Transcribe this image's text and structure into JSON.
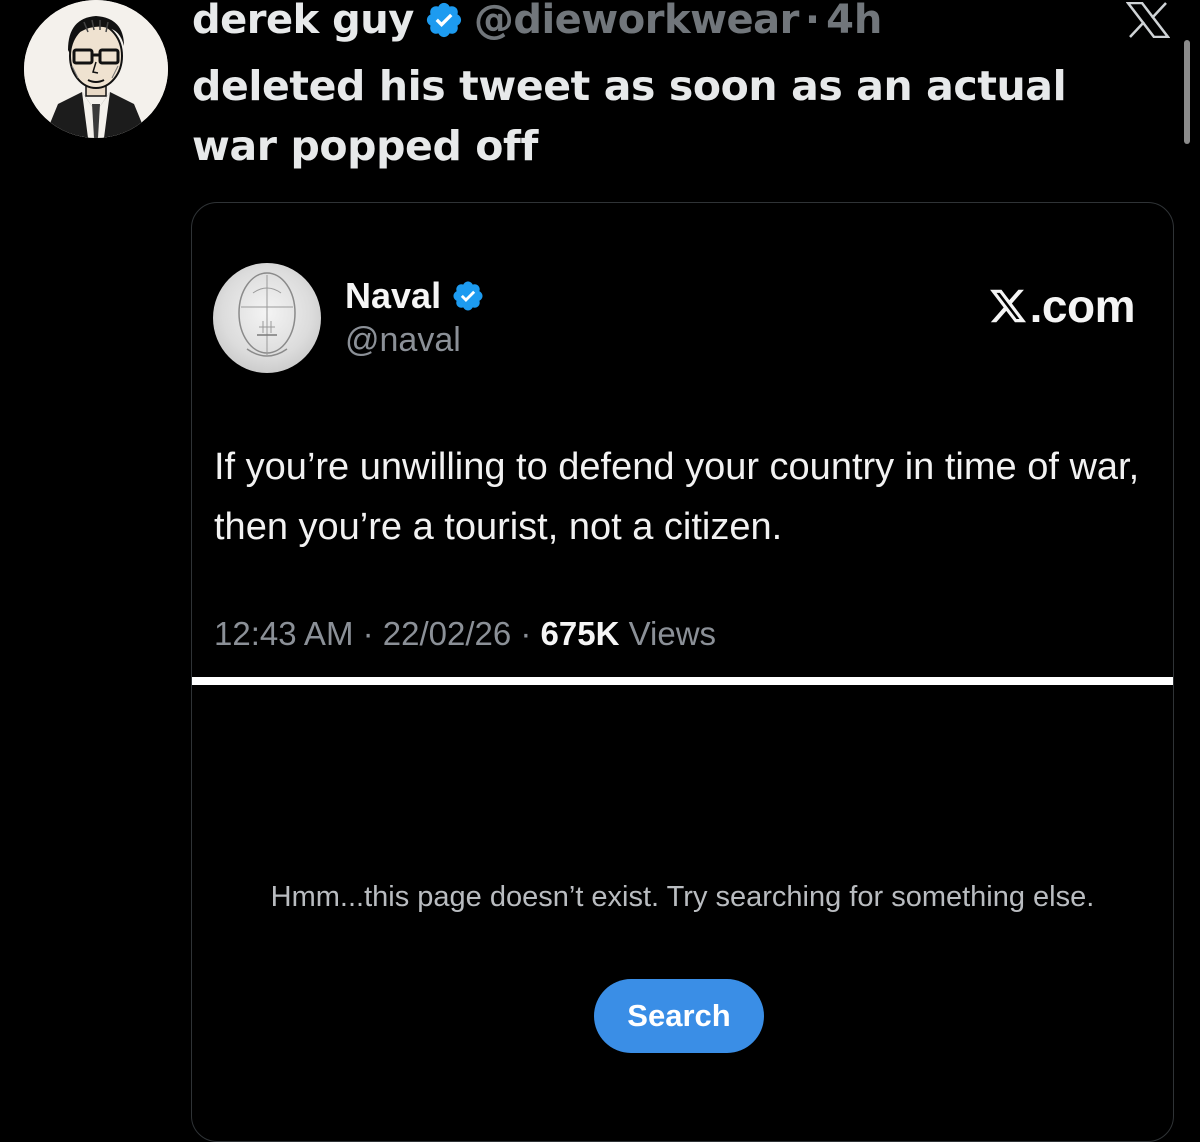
{
  "colors": {
    "background": "#000000",
    "text_primary": "#e7e9ea",
    "text_secondary": "#71767b",
    "verified_blue": "#1d9bf0",
    "search_button": "#3a8ee6",
    "card_border": "#2f3336"
  },
  "post": {
    "author": {
      "name": "derek guy",
      "handle": "@dieworkwear",
      "verified": true,
      "avatar_icon": "illustrated-man-portrait-avatar"
    },
    "separator": "·",
    "time_ago": "4h",
    "text": "deleted his tweet as soon as an actual war popped off",
    "close_icon": "x-logo-close-icon"
  },
  "quoted": {
    "author": {
      "name": "Naval",
      "handle": "@naval",
      "verified": true,
      "avatar_icon": "sketched-head-avatar"
    },
    "site_label": ".com",
    "site_icon": "x-logo-icon",
    "text": "If you’re unwilling to defend your country in time of war, then you’re a tourist, not a citizen.",
    "timestamp": "12:43 AM · 22/02/26 · ",
    "views_count": "675K",
    "views_label": " Views"
  },
  "error_page": {
    "message": "Hmm...this page doesn’t exist. Try searching for something else.",
    "search_label": "Search"
  }
}
